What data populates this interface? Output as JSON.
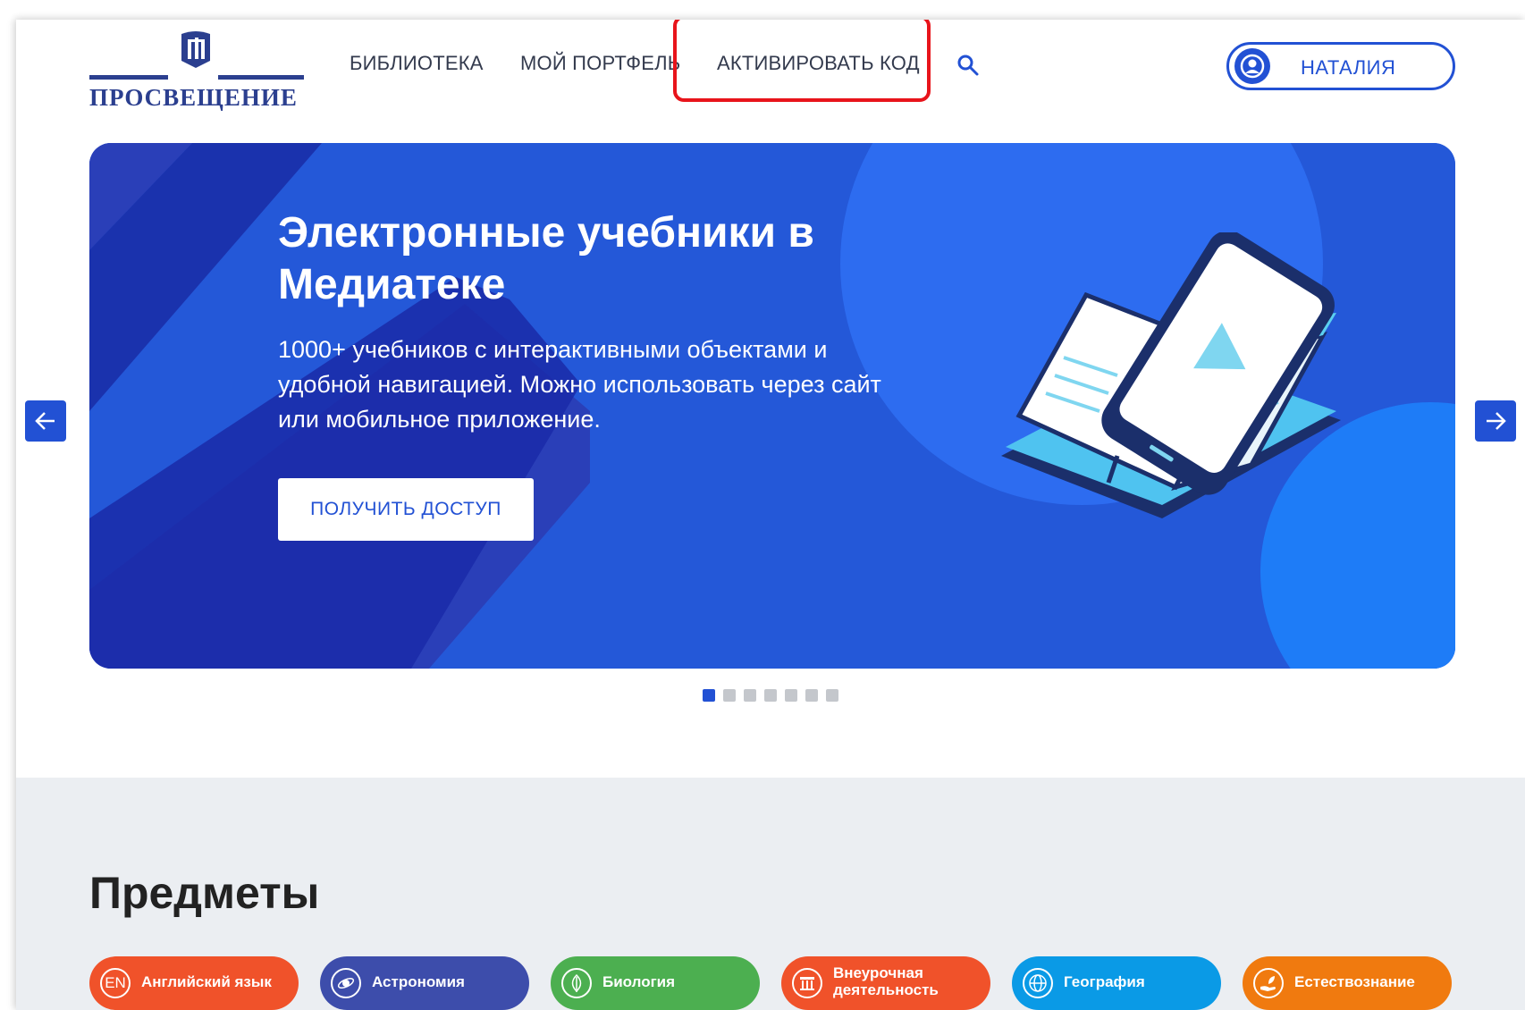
{
  "header": {
    "logo_text": "ПРОСВЕЩЕНИЕ",
    "nav": [
      {
        "label": "БИБЛИОТЕКА"
      },
      {
        "label": "МОЙ ПОРТФЕЛЬ"
      },
      {
        "label": "АКТИВИРОВАТЬ КОД"
      }
    ],
    "search_icon": "search-icon",
    "user_name": "НАТАЛИЯ",
    "highlight_color": "#e8141b"
  },
  "banner": {
    "title": "Электронные учебники в Медиатеке",
    "text": "1000+ учебников с интерактивными объектами и удобной навигацией. Можно использовать через сайт или мобильное приложение.",
    "button_label": "ПОЛУЧИТЬ ДОСТУП",
    "background_color": "#2458d8",
    "slide_count": 7,
    "active_slide": 1
  },
  "subjects": {
    "title": "Предметы",
    "items": [
      {
        "label": "Английский язык",
        "icon": "EN",
        "color": "#f0522a"
      },
      {
        "label": "Астрономия",
        "icon": "astronomy-icon",
        "color": "#3d4dab"
      },
      {
        "label": "Биология",
        "icon": "leaf-icon",
        "color": "#4caf50"
      },
      {
        "label": "Внеурочная деятельность",
        "icon": "column-icon",
        "color": "#f0522a"
      },
      {
        "label": "География",
        "icon": "globe-icon",
        "color": "#0a9ae6"
      },
      {
        "label": "Естествознание",
        "icon": "plant-hand-icon",
        "color": "#f07a0f"
      }
    ]
  },
  "colors": {
    "accent": "#2251d4",
    "subjects_bg": "#ebeef2"
  }
}
